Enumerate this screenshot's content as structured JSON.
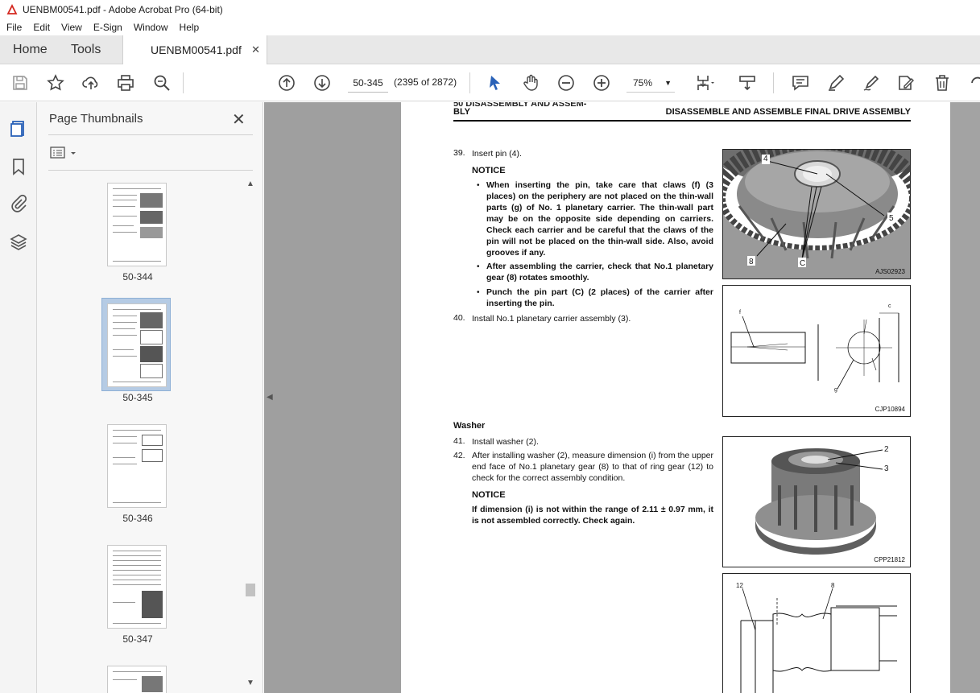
{
  "window": {
    "title": "UENBM00541.pdf - Adobe Acrobat Pro (64-bit)"
  },
  "menu": {
    "items": [
      "File",
      "Edit",
      "View",
      "E-Sign",
      "Window",
      "Help"
    ]
  },
  "tabs": {
    "home": "Home",
    "tools": "Tools",
    "document": "UENBM00541.pdf",
    "close": "✕"
  },
  "toolbar": {
    "page_value": "50-345",
    "page_count": "(2395 of 2872)",
    "zoom": "75%"
  },
  "thumbnails": {
    "title": "Page Thumbnails",
    "close": "✕",
    "pages": [
      {
        "label": "50-344",
        "selected": false
      },
      {
        "label": "50-345",
        "selected": true
      },
      {
        "label": "50-346",
        "selected": false
      },
      {
        "label": "50-347",
        "selected": false
      }
    ]
  },
  "document": {
    "header_left_top": "50 DISASSEMBLY AND ASSEM-",
    "header_left": "BLY",
    "header_right": "DISASSEMBLE AND ASSEMBLE FINAL DRIVE ASSEMBLY",
    "step39_num": "39.",
    "step39_text": "Insert pin (4).",
    "notice1": "NOTICE",
    "bullet1": "When inserting the pin, take care that claws (f) (3 places) on the periphery are not placed on the thin-wall parts (g) of No. 1 planetary carrier. The thin-wall part may be on the opposite side depending on carriers. Check each carrier and be careful that the claws of the pin will not be placed on the thin-wall side. Also, avoid grooves if any.",
    "bullet2": "After assembling the carrier, check that No.1 planetary gear (8) rotates smoothly.",
    "bullet3": "Punch the pin part (C) (2 places) of the carrier after inserting the pin.",
    "step40_num": "40.",
    "step40_text": "Install No.1 planetary carrier assembly (3).",
    "washer_title": "Washer",
    "step41_num": "41.",
    "step41_text": "Install washer (2).",
    "step42_num": "42.",
    "step42_text": "After installing washer (2), measure dimension (i) from the upper end face of No.1 planetary gear (8) to that of ring gear (12) to check for the correct assembly condition.",
    "notice2": "NOTICE",
    "notice2_text": "If dimension (i) is not within the range of 2.11 ± 0.97 mm, it is not assembled correctly. Check again.",
    "fig1_code": "AJS02923",
    "fig1_labels": {
      "a": "4",
      "b": "5",
      "c": "8",
      "d": "C"
    },
    "fig2_code": "CJP10894",
    "fig2_labels": {
      "f": "f",
      "c": "c",
      "g": "g"
    },
    "fig3_code": "CPP21812",
    "fig3_labels": {
      "a": "2",
      "b": "3"
    },
    "fig4_labels": {
      "a": "12",
      "b": "8"
    }
  },
  "colors": {
    "doc_background": "#9f9f9f",
    "accent_blue": "#2a62b8",
    "selection": "#b5cbe4"
  }
}
